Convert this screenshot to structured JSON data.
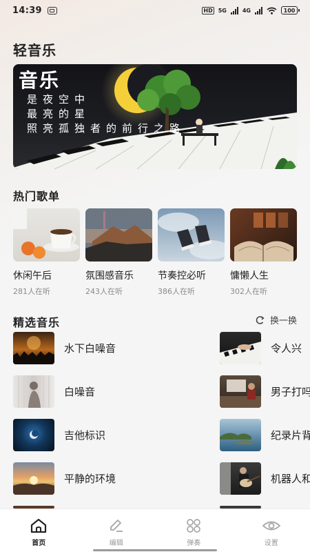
{
  "status_bar": {
    "time": "14:39",
    "network_1": "HD",
    "network_2": "5G",
    "network_3": "4G",
    "battery": "100"
  },
  "app": {
    "title": "轻音乐"
  },
  "banner": {
    "title": "音乐",
    "lines": [
      "是夜空中",
      "最亮的星",
      "照亮孤独者的前行之路"
    ]
  },
  "hot_playlists": {
    "title": "热门歌单",
    "items": [
      {
        "name": "休闲午后",
        "listeners": "281人在听",
        "cover": "tea-cup"
      },
      {
        "name": "氛围感音乐",
        "listeners": "243人在听",
        "cover": "mountain-sunset"
      },
      {
        "name": "节奏控必听",
        "listeners": "386人在听",
        "cover": "sneakers-sky"
      },
      {
        "name": "慵懒人生",
        "listeners": "302人在听",
        "cover": "open-book"
      }
    ]
  },
  "featured": {
    "title": "精选音乐",
    "refresh_label": "换一换",
    "left": [
      {
        "name": "水下白噪音",
        "thumb": "concert-crowd"
      },
      {
        "name": "白噪音",
        "thumb": "silhouette-curtain"
      },
      {
        "name": "吉他标识",
        "thumb": "blue-moon"
      },
      {
        "name": "平静的环境",
        "thumb": "sunset-clouds"
      }
    ],
    "right": [
      {
        "name": "令人兴",
        "thumb": "piano-hands"
      },
      {
        "name": "男子打吗",
        "thumb": "man-desk"
      },
      {
        "name": "纪录片背",
        "thumb": "coastal-island"
      },
      {
        "name": "机器人和",
        "thumb": "guitar-player"
      }
    ]
  },
  "bottom_nav": {
    "items": [
      {
        "label": "首页",
        "icon": "home-icon",
        "active": true
      },
      {
        "label": "编辑",
        "icon": "edit-icon",
        "active": false
      },
      {
        "label": "弹奏",
        "icon": "grid-icon",
        "active": false
      },
      {
        "label": "设置",
        "icon": "settings-icon",
        "active": false
      }
    ]
  },
  "colors": {
    "accent": "#222222",
    "muted": "#8a8a8a",
    "nav_inactive": "#999999"
  }
}
